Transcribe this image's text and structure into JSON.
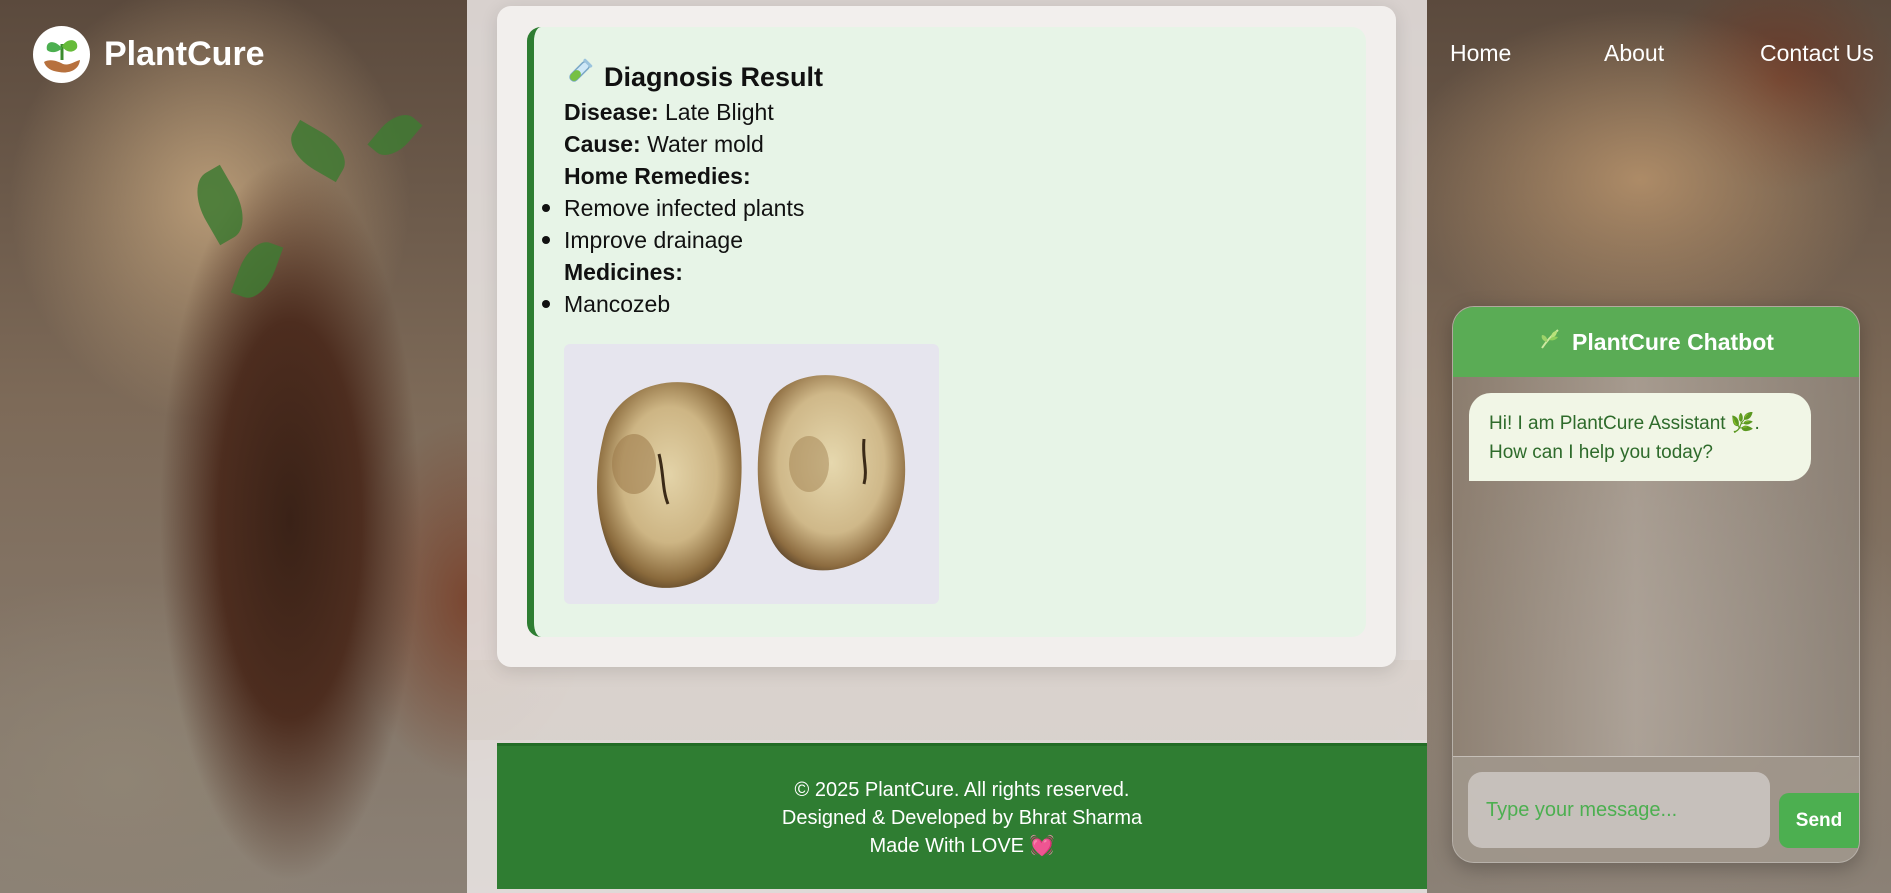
{
  "brand": {
    "name": "PlantCure",
    "logo_icon": "seedling-hand-icon"
  },
  "nav": {
    "items": [
      {
        "label": "Home"
      },
      {
        "label": "About"
      },
      {
        "label": "Contact Us"
      }
    ]
  },
  "diagnosis": {
    "title": "Diagnosis Result",
    "title_icon": "test-tube-icon",
    "disease_label": "Disease:",
    "disease_value": "Late Blight",
    "cause_label": "Cause:",
    "cause_value": "Water mold",
    "remedies_label": "Home Remedies:",
    "remedies": [
      "Remove infected plants",
      "Improve drainage"
    ],
    "medicines_label": "Medicines:",
    "medicines": [
      "Mancozeb"
    ],
    "image_subject": "cut potato with late blight"
  },
  "footer": {
    "copyright": "© 2025 PlantCure. All rights reserved.",
    "credits": "Designed & Developed by Bhrat Sharma",
    "love_text": "Made With LOVE",
    "heart": "💓"
  },
  "chatbot": {
    "title": "PlantCure Chatbot",
    "title_icon": "herb-icon",
    "greeting_line1": "Hi! I am PlantCure Assistant 🌿.",
    "greeting_line2": "How can I help you today?",
    "input_placeholder": "Type your message...",
    "input_value": "",
    "send_label": "Send"
  },
  "colors": {
    "accent_green": "#2e7d32",
    "chat_green": "#5aac55",
    "result_bg": "#e7f4e7"
  }
}
